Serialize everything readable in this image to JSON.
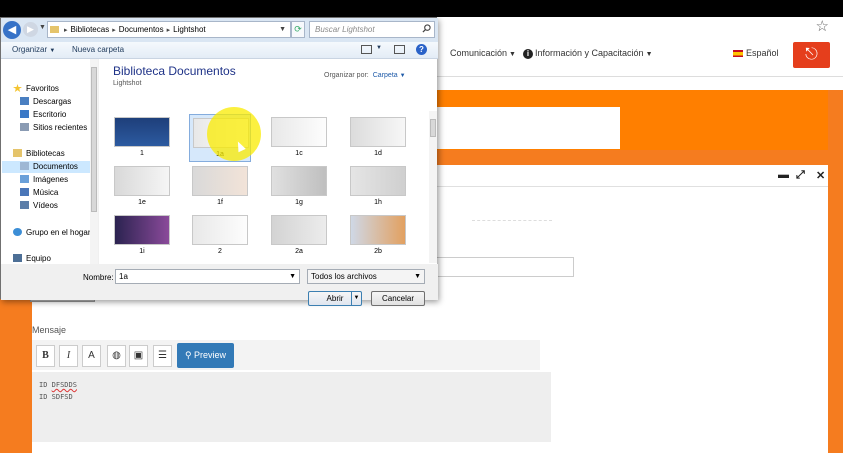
{
  "browser": {
    "nav_items": [
      {
        "label": "Comunicación"
      },
      {
        "label": "Información y Capacitación"
      },
      {
        "label": "Español"
      }
    ],
    "logout_glyph": "⎋"
  },
  "form": {
    "mensaje_label": "Mensaje",
    "toolbar": {
      "bold": "B",
      "italic": "I",
      "font": "A",
      "preview_label": "Preview"
    },
    "editor_lines": [
      {
        "prefix": "ID",
        "text": "DFSDDS"
      },
      {
        "prefix": "ID",
        "text": "SDFSD"
      }
    ]
  },
  "dialog": {
    "breadcrumb": [
      "Bibliotecas",
      "Documentos",
      "Lightshot"
    ],
    "search_placeholder": "Buscar Lightshot",
    "organize_label": "Organizar",
    "new_folder_label": "Nueva carpeta",
    "nav_pane": {
      "favorites": "Favoritos",
      "favorites_items": [
        "Descargas",
        "Escritorio",
        "Sitios recientes"
      ],
      "libraries": "Bibliotecas",
      "libraries_items": [
        "Documentos",
        "Imágenes",
        "Música",
        "Vídeos"
      ],
      "homegroup": "Grupo en el hogar",
      "computer": "Equipo"
    },
    "library_title": "Biblioteca Documentos",
    "library_subtitle": "Lightshot",
    "organize_by_label": "Organizar por:",
    "organize_by_value": "Carpeta",
    "files": [
      {
        "name": "1"
      },
      {
        "name": "1a"
      },
      {
        "name": "1c"
      },
      {
        "name": "1d"
      },
      {
        "name": "1e"
      },
      {
        "name": "1f"
      },
      {
        "name": "1g"
      },
      {
        "name": "1h"
      },
      {
        "name": "1i"
      },
      {
        "name": "2"
      },
      {
        "name": "2a"
      },
      {
        "name": "2b"
      }
    ],
    "selected_file": "1a",
    "name_label": "Nombre:",
    "name_value": "1a",
    "file_type": "Todos los archivos",
    "open_label": "Abrir",
    "cancel_label": "Cancelar"
  }
}
